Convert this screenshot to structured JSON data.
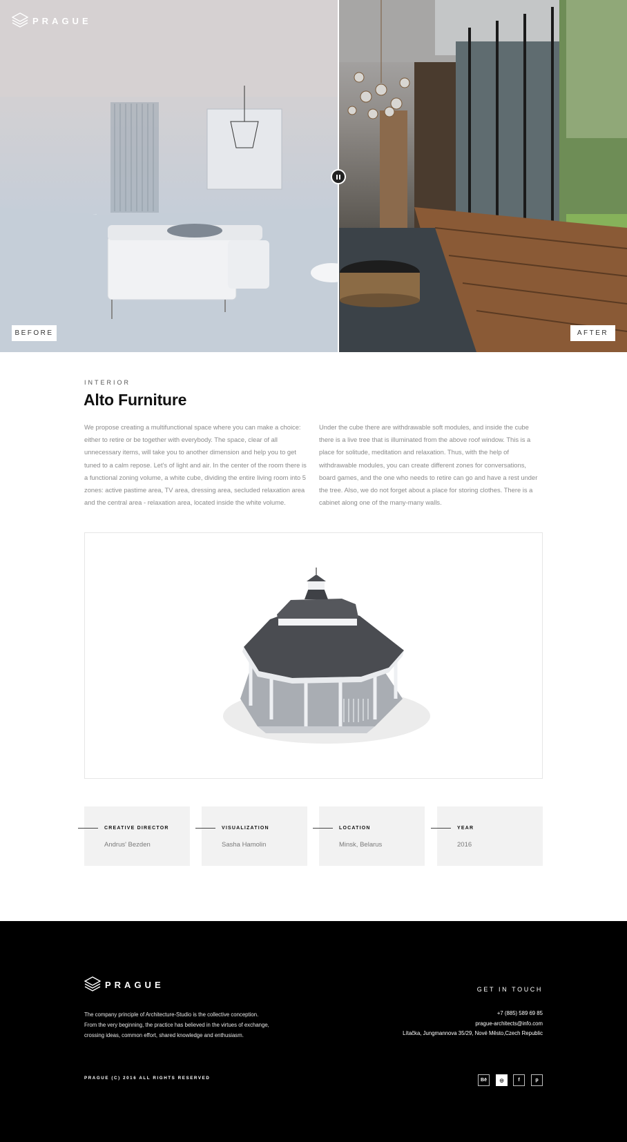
{
  "brand": {
    "name": "PRAGUE"
  },
  "hero": {
    "before_label": "BEFORE",
    "after_label": "AFTER"
  },
  "project": {
    "category": "INTERIOR",
    "title": "Alto Furniture",
    "paragraph_left": "We propose creating a multifunctional space where you can make a choice: either to retire or be together with everybody. The space, clear of all unnecessary items, will take you to another dimension and help you to get tuned to a calm repose.  Let's of light and air. In the center of the room there is a functional zoning volume, a white cube, dividing the entire living room into 5 zones: active pastime area, TV area, dressing area, secluded relaxation area and the central area - relaxation area, located inside the white volume.",
    "paragraph_right": "Under the cube there are withdrawable soft modules, and inside the cube there is a live tree that is illuminated from the above roof window. This is a place for solitude, meditation and relaxation. Thus, with the help of withdrawable modules, you can create different zones for conversations, board games, and the one who needs to retire can go and have a rest under the tree. Also, we do not forget about a place for storing clothes. There is a cabinet along one of the many-many walls."
  },
  "credits": [
    {
      "label": "CREATIVE DIRECTOR",
      "value": "Andrus' Bezden"
    },
    {
      "label": "VISUALIZATION",
      "value": "Sasha Hamolin"
    },
    {
      "label": "LOCATION",
      "value": "Minsk, Belarus"
    },
    {
      "label": "YEAR",
      "value": "2016"
    }
  ],
  "footer": {
    "about": "The company principle of Architecture-Studio is the collective conception. From the very beginning, the practice has believed in the virtues of exchange, crossing ideas, common effort, shared knowledge and enthusiasm.",
    "get_in_touch": "GET IN TOUCH",
    "phone": "+7 (885) 589 69 85",
    "email": "prague-architects@info.com",
    "address": "Lítačka, Jungmannova 35/29, Nové Město,Czech Republic",
    "copyright": "PRAGUE (C) 2016 ALL RIGHTS RESERVED",
    "social": [
      {
        "icon": "behance-icon",
        "glyph": "Bē"
      },
      {
        "icon": "dribbble-icon",
        "glyph": "◎"
      },
      {
        "icon": "facebook-icon",
        "glyph": "f"
      },
      {
        "icon": "pinterest-icon",
        "glyph": "p"
      }
    ]
  }
}
